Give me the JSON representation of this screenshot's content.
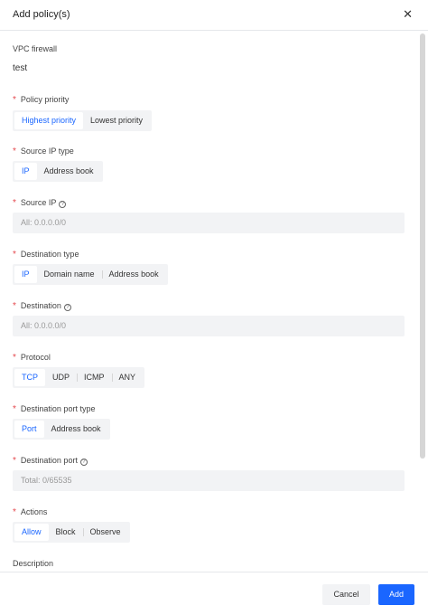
{
  "dialog": {
    "title": "Add policy(s)",
    "close_glyph": "✕"
  },
  "vpc": {
    "label": "VPC firewall",
    "value": "test"
  },
  "required_mark": "*",
  "help_glyph": "?",
  "policy_priority": {
    "label": "Policy priority",
    "options": [
      "Highest priority",
      "Lowest priority"
    ],
    "selected": 0
  },
  "source_ip_type": {
    "label": "Source IP type",
    "options": [
      "IP",
      "Address book"
    ],
    "selected": 0
  },
  "source_ip": {
    "label": "Source IP",
    "placeholder": "All: 0.0.0.0/0"
  },
  "destination_type": {
    "label": "Destination type",
    "options": [
      "IP",
      "Domain name",
      "Address book"
    ],
    "selected": 0
  },
  "destination": {
    "label": "Destination",
    "placeholder": "All: 0.0.0.0/0"
  },
  "protocol": {
    "label": "Protocol",
    "options": [
      "TCP",
      "UDP",
      "ICMP",
      "ANY"
    ],
    "selected": 0
  },
  "destination_port_type": {
    "label": "Destination port type",
    "options": [
      "Port",
      "Address book"
    ],
    "selected": 0
  },
  "destination_port": {
    "label": "Destination port",
    "placeholder": "Total: 0/65535"
  },
  "actions": {
    "label": "Actions",
    "options": [
      "Allow",
      "Block",
      "Observe"
    ],
    "selected": 0
  },
  "description": {
    "label": "Description"
  },
  "footer": {
    "cancel_label": "Cancel",
    "add_label": "Add"
  },
  "colors": {
    "accent": "#1a66ff",
    "required": "#e5484d",
    "control_bg": "#f2f3f5"
  }
}
